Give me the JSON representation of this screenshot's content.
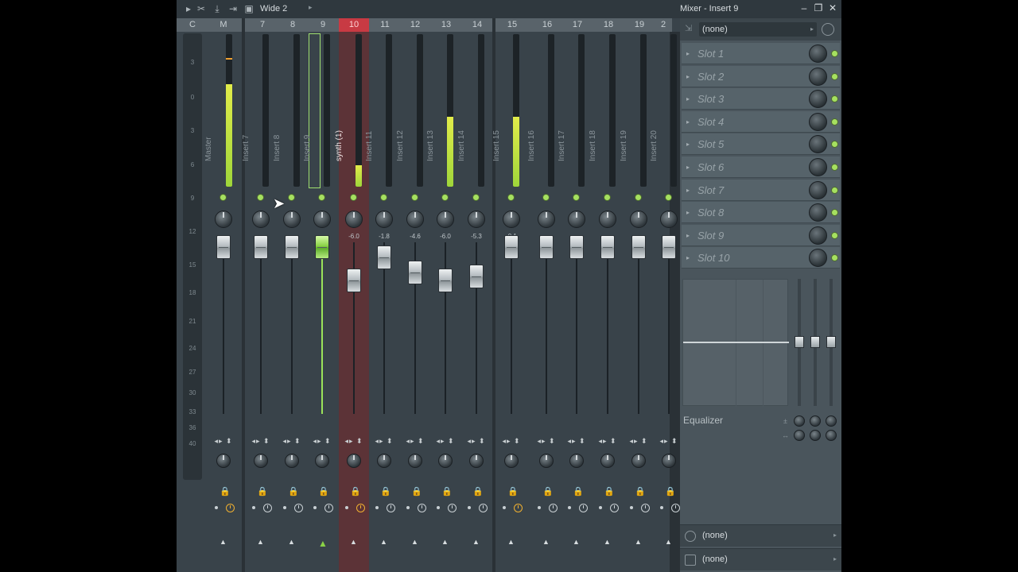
{
  "toolbar": {
    "preset": "Wide 2",
    "window_title": "Mixer - Insert 9"
  },
  "header": {
    "labels": [
      "C",
      "M",
      "7",
      "8",
      "9",
      "10",
      "11",
      "12",
      "13",
      "14",
      "15",
      "16",
      "17",
      "18",
      "19",
      "2"
    ]
  },
  "scale": [
    "3",
    "0",
    "3",
    "6",
    "9",
    "12",
    "15",
    "18",
    "21",
    "24",
    "27",
    "30",
    "33",
    "36",
    "40"
  ],
  "strips": [
    {
      "name": "Master",
      "db": "",
      "meter": 0.67,
      "peak": true
    },
    {
      "name": "Insert 7",
      "db": "",
      "meter": 0
    },
    {
      "name": "Insert 8",
      "db": "",
      "meter": 0
    },
    {
      "name": "Insert 9",
      "db": "",
      "meter": 0
    },
    {
      "name": "synth (1)",
      "db": "-6.0",
      "meter": 0.14
    },
    {
      "name": "Insert 11",
      "db": "-1.8",
      "meter": 0
    },
    {
      "name": "Insert 12",
      "db": "-4.6",
      "meter": 0
    },
    {
      "name": "Insert 13",
      "db": "-6.0",
      "meter": 0.46
    },
    {
      "name": "Insert 14",
      "db": "-5.3",
      "meter": 0
    },
    {
      "name": "Insert 15",
      "db": "-0.1",
      "meter": 0.46
    },
    {
      "name": "Insert 16",
      "db": "",
      "meter": 0
    },
    {
      "name": "Insert 17",
      "db": "",
      "meter": 0
    },
    {
      "name": "Insert 18",
      "db": "",
      "meter": 0
    },
    {
      "name": "Insert 19",
      "db": "",
      "meter": 0
    },
    {
      "name": "Insert 20",
      "db": "",
      "meter": 0
    }
  ],
  "panel": {
    "input": "(none)",
    "slots": [
      "Slot 1",
      "Slot 2",
      "Slot 3",
      "Slot 4",
      "Slot 5",
      "Slot 6",
      "Slot 7",
      "Slot 8",
      "Slot 9",
      "Slot 10"
    ],
    "eq_label": "Equalizer",
    "output1": "(none)",
    "output2": "(none)"
  },
  "colors": {
    "accent_green": "#a6e060",
    "selected_red": "#c83a43",
    "peak_orange": "#f0b030"
  }
}
